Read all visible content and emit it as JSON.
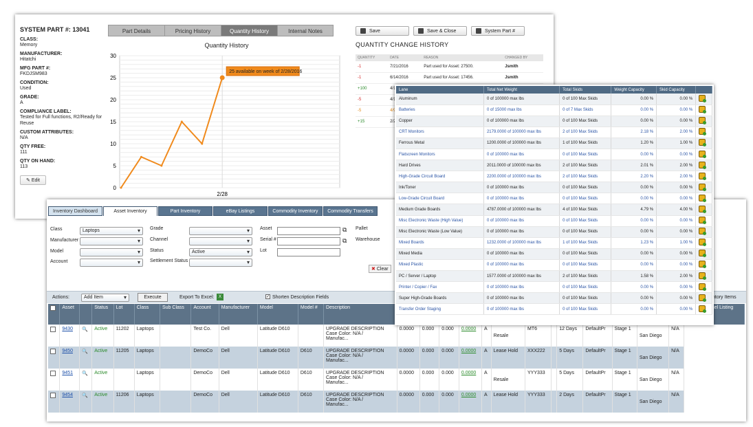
{
  "part": {
    "title": "SYSTEM PART #: 13041",
    "fields": [
      {
        "label": "CLASS:",
        "value": "Memory"
      },
      {
        "label": "MANUFACTURER:",
        "value": "Hitatchi"
      },
      {
        "label": "MFG PART #:",
        "value": "FKDJSM983"
      },
      {
        "label": "CONDITION:",
        "value": "Used"
      },
      {
        "label": "GRADE:",
        "value": "A"
      },
      {
        "label": "COMPLIANCE LABEL:",
        "value": "Tested for Full functions, R2/Ready for Reuse"
      },
      {
        "label": "CUSTOM ATTRIBUTES:",
        "value": "N/A"
      },
      {
        "label": "QTY FREE:",
        "value": "111"
      },
      {
        "label": "QTY ON HAND:",
        "value": "113"
      }
    ],
    "edit_label": "Edit",
    "tabs": [
      "Part Details",
      "Pricing History",
      "Quantity History",
      "Internal Notes"
    ],
    "active_tab": "Quantity History",
    "buttons": [
      "Save",
      "Save & Close",
      "System Part #"
    ],
    "history_title": "QUANTITY CHANGE HISTORY",
    "history_headers": [
      "QUANTITY",
      "DATE",
      "REASON",
      "CHANGED BY"
    ],
    "history_rows": [
      {
        "qty": "-1",
        "date": "7/21/2016",
        "reason": "Part used for Asset: 27500.",
        "by": "Jsmith",
        "color": "#d42a2a"
      },
      {
        "qty": "-1",
        "date": "6/14/2016",
        "reason": "Part used for Asset: 17456.",
        "by": "Jsmith",
        "color": "#d42a2a"
      },
      {
        "qty": "+100",
        "date": "4/11/2",
        "reason": "",
        "by": "",
        "color": "#2a8a2a"
      },
      {
        "qty": "-5",
        "date": "4/11/2",
        "reason": "",
        "by": "",
        "color": "#d42a2a"
      },
      {
        "qty": "-5",
        "date": "4/9/20",
        "reason": "",
        "by": "",
        "color": "#e08a1a"
      },
      {
        "qty": "+15",
        "date": "2/22/2",
        "reason": "",
        "by": "",
        "color": "#2a8a2a"
      }
    ]
  },
  "chart_data": {
    "type": "line",
    "title": "Quantity History",
    "y_ticks": [
      "0",
      "5",
      "10",
      "15",
      "20",
      "25",
      "30"
    ],
    "x_ticks": [
      "2/28"
    ],
    "ylim": [
      0,
      30
    ],
    "values": [
      0,
      7,
      5,
      15,
      10,
      25
    ],
    "highlight_index": 5,
    "tooltip": "25 available on week of 2/28/2016",
    "line_color": "#f08a1c",
    "grid": true
  },
  "inventory": {
    "tabs": [
      "Inventory Dashboard",
      "Asset Inventory",
      "Part Inventory",
      "eBay Listings",
      "Commodity Inventory",
      "Commodity Transfers"
    ],
    "filters": {
      "class_label": "Class",
      "class_value": "Laptops",
      "manufacturer_label": "Manufacturer",
      "model_label": "Model",
      "account_label": "Account",
      "grade_label": "Grade",
      "channel_label": "Channel",
      "status_label": "Status",
      "status_value": "Active",
      "settlement_label": "Settlement Status",
      "asset_label": "Asset",
      "serial_label": "Serial #",
      "lot_label": "Lot",
      "pallet_label": "Pallet",
      "warehouse_label": "Warehouse",
      "clear_label": "Clear"
    },
    "actions": {
      "label": "Actions:",
      "select": "Add Item",
      "execute": "Execute",
      "export": "Export To Excel:",
      "shorten": "Shorten Description Fields",
      "inventory_items": "ntory Items"
    },
    "headers": [
      "",
      "Asset",
      "",
      "Status",
      "Lot",
      "Class",
      "Sub Class",
      "Account",
      "Manufacturer",
      "Model",
      "Model #",
      "Description",
      "Upg",
      "",
      "",
      "",
      "",
      "",
      "",
      "",
      "",
      "",
      "",
      "",
      "",
      "OMNI Channel Listing"
    ],
    "rows": [
      {
        "asset": "9430",
        "status": "Active",
        "lot": "11202",
        "class": "Laptops",
        "account": "Test Co.",
        "mfr": "Dell",
        "model": "Latitude D610",
        "modelno": "",
        "desc1": "UPGRADE DESCRIPTION",
        "desc2": "Case Color: N/A /",
        "desc3": "Manufac...",
        "v1": "0.0000",
        "v2": "0.000",
        "v3": "0.000",
        "v4": "0.0000",
        "grade": "A",
        "type": "Resale",
        "tag": "MT6",
        "days": "12 Days",
        "dp": "DefaultPr",
        "stage": "Stage 1",
        "city": "San Diego",
        "omni": "N/A"
      },
      {
        "asset": "9450",
        "status": "Active",
        "lot": "11205",
        "class": "Laptops",
        "account": "DemoCo",
        "mfr": "Dell",
        "model": "Latitude D610",
        "modelno": "D610",
        "desc1": "UPGRADE DESCRIPTION",
        "desc2": "Case Color: N/A /",
        "desc3": "Manufac...",
        "v1": "0.0000",
        "v2": "0.000",
        "v3": "0.000",
        "v4": "0.0000",
        "grade": "A",
        "type": "Lease Hold",
        "tag": "XXX222",
        "days": "5 Days",
        "dp": "DefaultPr",
        "stage": "Stage 1",
        "city": "San Diego",
        "omni": "N/A"
      },
      {
        "asset": "9451",
        "status": "Active",
        "lot": "",
        "class": "Laptops",
        "account": "DemoCo",
        "mfr": "Dell",
        "model": "Latitude D610",
        "modelno": "D610",
        "desc1": "UPGRADE DESCRIPTION",
        "desc2": "Case Color: N/A /",
        "desc3": "Manufac...",
        "v1": "0.0000",
        "v2": "0.000",
        "v3": "0.000",
        "v4": "0.0000",
        "grade": "A",
        "type": "Resale",
        "tag": "YYY333",
        "days": "5 Days",
        "dp": "DefaultPr",
        "stage": "Stage 1",
        "city": "San Diego",
        "omni": "N/A"
      },
      {
        "asset": "9454",
        "status": "Active",
        "lot": "11206",
        "class": "Laptops",
        "account": "DemoCo",
        "mfr": "Dell",
        "model": "Latitude D610",
        "modelno": "D610",
        "desc1": "UPGRADE DESCRIPTION",
        "desc2": "Case Color: N/A /",
        "desc3": "Manufac...",
        "v1": "0.0000",
        "v2": "0.000",
        "v3": "0.000",
        "v4": "0.0000",
        "grade": "A",
        "type": "Lease Hold",
        "tag": "YYY333",
        "days": "2 Days",
        "dp": "DefaultPr",
        "stage": "Stage 1",
        "city": "San Diego",
        "omni": "N/A"
      }
    ]
  },
  "lanes": {
    "headers": [
      "Lane",
      "Total Net Weight",
      "Total Skids",
      "Weight Capacity",
      "Skid Capacity"
    ],
    "rows": [
      {
        "lane": "Aluminum",
        "weight": "0 of 100000 max lbs",
        "skids": "0 of 100 Max Skids",
        "wcap": "0.00 %",
        "scap": "0.00 %",
        "link": false
      },
      {
        "lane": "Batteries",
        "weight": "0 of 15000 max lbs",
        "skids": "0 of 7 Max Skids",
        "wcap": "0.00 %",
        "scap": "0.00 %",
        "link": true
      },
      {
        "lane": "Copper",
        "weight": "0 of 100000 max lbs",
        "skids": "0 of 100 Max Skids",
        "wcap": "0.00 %",
        "scap": "0.00 %",
        "link": false
      },
      {
        "lane": "CRT Monitors",
        "weight": "2179.0000 of 100000 max lbs",
        "skids": "2 of 100 Max Skids",
        "wcap": "2.18 %",
        "scap": "2.00 %",
        "link": true
      },
      {
        "lane": "Ferrous Metal",
        "weight": "1200.0000 of 100000 max lbs",
        "skids": "1 of 100 Max Skids",
        "wcap": "1.20 %",
        "scap": "1.00 %",
        "link": false
      },
      {
        "lane": "Flatscreen Monitors",
        "weight": "0 of 100000 max lbs",
        "skids": "0 of 100 Max Skids",
        "wcap": "0.00 %",
        "scap": "0.00 %",
        "link": true
      },
      {
        "lane": "Hard Drives",
        "weight": "2011.0000 of 100000 max lbs",
        "skids": "2 of 100 Max Skids",
        "wcap": "2.01 %",
        "scap": "2.00 %",
        "link": false
      },
      {
        "lane": "High-Grade Circuit Board",
        "weight": "2200.0000 of 100000 max lbs",
        "skids": "2 of 100 Max Skids",
        "wcap": "2.20 %",
        "scap": "2.00 %",
        "link": true
      },
      {
        "lane": "Ink/Toner",
        "weight": "0 of 100000 max lbs",
        "skids": "0 of 100 Max Skids",
        "wcap": "0.00 %",
        "scap": "0.00 %",
        "link": false
      },
      {
        "lane": "Low-Grade Circuit Board",
        "weight": "0 of 100000 max lbs",
        "skids": "0 of 100 Max Skids",
        "wcap": "0.00 %",
        "scap": "0.00 %",
        "link": true
      },
      {
        "lane": "Medium Grade Boards",
        "weight": "4787.0000 of 100000 max lbs",
        "skids": "4 of 100 Max Skids",
        "wcap": "4.79 %",
        "scap": "4.00 %",
        "link": false
      },
      {
        "lane": "Misc Electronic Waste (High Value)",
        "weight": "0 of 100000 max lbs",
        "skids": "0 of 100 Max Skids",
        "wcap": "0.00 %",
        "scap": "0.00 %",
        "link": true
      },
      {
        "lane": "Misc Electronic Waste (Low Value)",
        "weight": "0 of 100000 max lbs",
        "skids": "0 of 100 Max Skids",
        "wcap": "0.00 %",
        "scap": "0.00 %",
        "link": false
      },
      {
        "lane": "Mixed Boards",
        "weight": "1232.0000 of 100000 max lbs",
        "skids": "1 of 100 Max Skids",
        "wcap": "1.23 %",
        "scap": "1.00 %",
        "link": true
      },
      {
        "lane": "Mixed Media",
        "weight": "0 of 100000 max lbs",
        "skids": "0 of 100 Max Skids",
        "wcap": "0.00 %",
        "scap": "0.00 %",
        "link": false
      },
      {
        "lane": "Mixed Plastic",
        "weight": "0 of 100000 max lbs",
        "skids": "0 of 100 Max Skids",
        "wcap": "0.00 %",
        "scap": "0.00 %",
        "link": true
      },
      {
        "lane": "PC / Server / Laptop",
        "weight": "1577.0000 of 100000 max lbs",
        "skids": "2 of 100 Max Skids",
        "wcap": "1.58 %",
        "scap": "2.00 %",
        "link": false
      },
      {
        "lane": "Printer / Copier / Fax",
        "weight": "0 of 100000 max lbs",
        "skids": "0 of 100 Max Skids",
        "wcap": "0.00 %",
        "scap": "0.00 %",
        "link": true
      },
      {
        "lane": "Super High-Grade Boards",
        "weight": "0 of 100000 max lbs",
        "skids": "0 of 100 Max Skids",
        "wcap": "0.00 %",
        "scap": "0.00 %",
        "link": false
      },
      {
        "lane": "Transfer Order Staging",
        "weight": "0 of 100000 max lbs",
        "skids": "0 of 100 Max Skids",
        "wcap": "0.00 %",
        "scap": "0.00 %",
        "link": true
      }
    ]
  }
}
